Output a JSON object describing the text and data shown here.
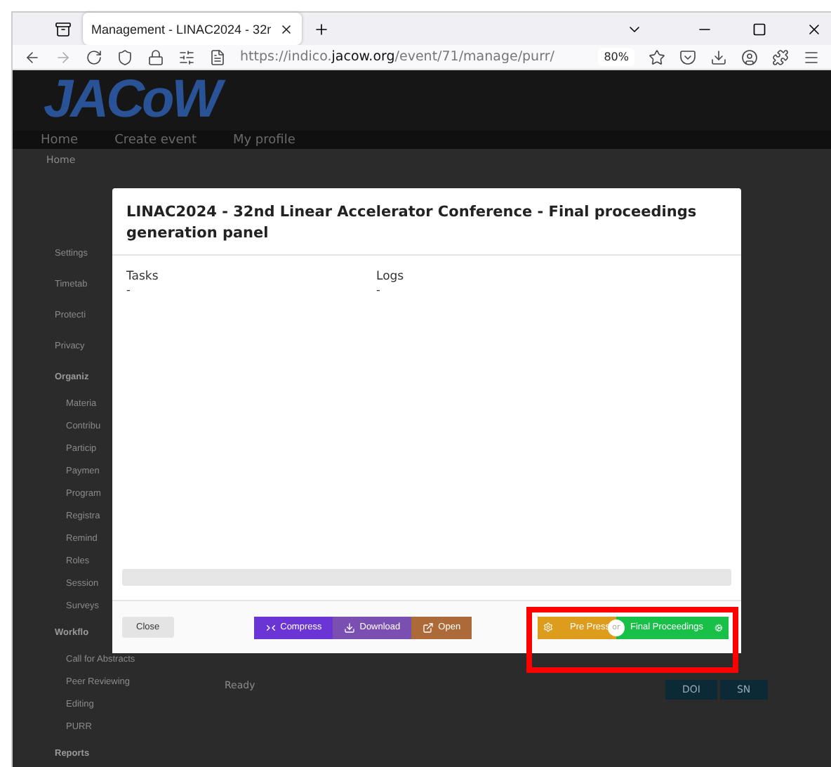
{
  "browser": {
    "tabs": [
      {
        "title": "Management - LINAC2024 - 32r",
        "selected": true
      }
    ],
    "url": "https://indico.**jacow.org**/event/71/manage/purr/",
    "zoom": "80%"
  },
  "site": {
    "logo": "JACoW",
    "nav": [
      "Home",
      "Create event",
      "My profile"
    ],
    "breadcrumb": "Home",
    "sidebar": [
      {
        "label": "Settings",
        "kind": "item"
      },
      {
        "label": "Timetab",
        "kind": "item"
      },
      {
        "label": "Protecti",
        "kind": "item"
      },
      {
        "label": "Privacy",
        "kind": "item"
      },
      {
        "label": "Organiz",
        "kind": "section",
        "children": [
          {
            "label": "Materia"
          },
          {
            "label": "Contribu"
          },
          {
            "label": "Particip"
          },
          {
            "label": "Paymen"
          },
          {
            "label": "Program"
          },
          {
            "label": "Registra"
          },
          {
            "label": "Remind"
          },
          {
            "label": "Roles"
          },
          {
            "label": "Session"
          },
          {
            "label": "Surveys"
          }
        ]
      },
      {
        "label": "Workflo",
        "kind": "section",
        "children": [
          {
            "label": "Call for Abstracts"
          },
          {
            "label": "Peer Reviewing"
          },
          {
            "label": "Editing"
          },
          {
            "label": "PURR"
          }
        ]
      },
      {
        "label": "Reports",
        "kind": "section"
      }
    ],
    "status": "Ready",
    "actions": [
      "DOI",
      "SN"
    ]
  },
  "modal": {
    "title": "LINAC2024 - 32nd Linear Accelerator Conference - Final proceedings generation panel",
    "tasks": {
      "label": "Tasks",
      "value": "-"
    },
    "logs": {
      "label": "Logs",
      "value": "-"
    },
    "progress": {
      "level": 0
    },
    "close": "Close",
    "file_actions": [
      {
        "label": "Compress",
        "kind": "compress"
      },
      {
        "label": "Download",
        "kind": "download"
      },
      {
        "label": "Open",
        "kind": "open"
      }
    ],
    "pre_press": "Pre Press",
    "separator": "or",
    "final": "Final Proceedings"
  },
  "highlight": {
    "shown": true
  }
}
